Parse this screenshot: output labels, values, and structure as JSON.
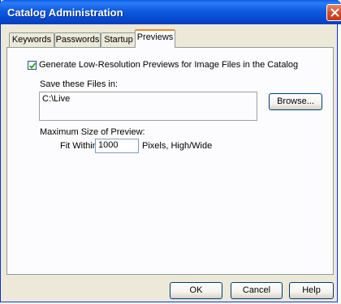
{
  "window": {
    "title": "Catalog Administration"
  },
  "tabs": [
    {
      "label": "Keywords"
    },
    {
      "label": "Passwords"
    },
    {
      "label": "Startup"
    },
    {
      "label": "Previews"
    }
  ],
  "previews": {
    "generate_label": "Generate Low-Resolution Previews for Image Files in the Catalog",
    "generate_checked": true,
    "save_label": "Save these Files in:",
    "save_path": "C:\\Live",
    "browse_label": "Browse...",
    "max_size_label": "Maximum Size of Preview:",
    "fit_within_label": "Fit Within:",
    "fit_within_value": "1000",
    "units_label": "Pixels, High/Wide"
  },
  "buttons": {
    "ok": "OK",
    "cancel": "Cancel",
    "help": "Help"
  },
  "colors": {
    "titlebar": "#0a5ee6",
    "face": "#ece9d8",
    "tab_highlight": "#e68b2c",
    "close": "#d14a26"
  }
}
